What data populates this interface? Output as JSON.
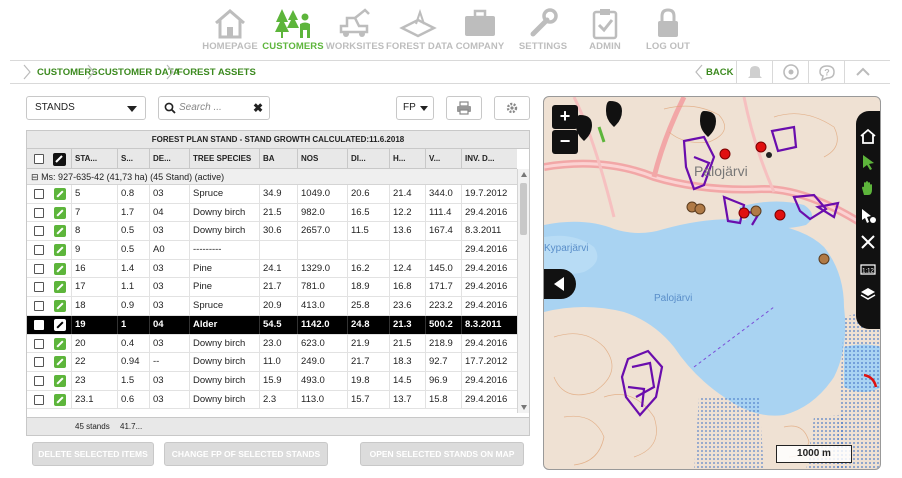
{
  "nav": [
    {
      "label": "HOMEPAGE",
      "icon": "home-icon",
      "active": false
    },
    {
      "label": "CUSTOMERS",
      "icon": "customers-icon",
      "active": true
    },
    {
      "label": "WORKSITES",
      "icon": "worksites-icon",
      "active": false
    },
    {
      "label": "FOREST DATA",
      "icon": "forest-data-icon",
      "active": false
    },
    {
      "label": "COMPANY",
      "icon": "briefcase-icon",
      "active": false
    },
    {
      "label": "SETTINGS",
      "icon": "wrench-icon",
      "active": false
    },
    {
      "label": "ADMIN",
      "icon": "clipboard-icon",
      "active": false
    },
    {
      "label": "LOG OUT",
      "icon": "lock-icon",
      "active": false
    }
  ],
  "breadcrumb": [
    "CUSTOMERS",
    "CUSTOMER DATA",
    "FOREST ASSETS"
  ],
  "back_label": "BACK",
  "controls": {
    "stands_select": "STANDS",
    "search_placeholder": "Search ...",
    "fp_select": "FP"
  },
  "grid": {
    "title": "FOREST PLAN STAND - STAND GROWTH CALCULATED:11.6.2018",
    "columns": [
      "STA...",
      "S...",
      "DE...",
      "TREE SPECIES",
      "BA",
      "NOS",
      "DI...",
      "H...",
      "V...",
      "INV. D..."
    ],
    "group": "Ms: 927-635-42 (41,73 ha) (45 Stand) (active)",
    "rows": [
      [
        "5",
        "0.8",
        "03",
        "Spruce",
        "34.9",
        "1049.0",
        "20.6",
        "21.4",
        "344.0",
        "19.7.2012"
      ],
      [
        "7",
        "1.7",
        "04",
        "Downy birch",
        "21.5",
        "982.0",
        "16.5",
        "12.2",
        "111.4",
        "29.4.2016"
      ],
      [
        "8",
        "0.5",
        "03",
        "Downy birch",
        "30.6",
        "2657.0",
        "11.5",
        "13.6",
        "167.4",
        "8.3.2011"
      ],
      [
        "9",
        "0.5",
        "A0",
        "---------",
        "",
        "",
        "",
        "",
        "",
        "29.4.2016"
      ],
      [
        "16",
        "1.4",
        "03",
        "Pine",
        "24.1",
        "1329.0",
        "16.2",
        "12.4",
        "145.0",
        "29.4.2016"
      ],
      [
        "17",
        "1.1",
        "03",
        "Pine",
        "21.7",
        "781.0",
        "18.9",
        "16.8",
        "171.7",
        "29.4.2016"
      ],
      [
        "18",
        "0.9",
        "03",
        "Spruce",
        "20.9",
        "413.0",
        "25.8",
        "23.6",
        "223.2",
        "29.4.2016"
      ],
      [
        "19",
        "1",
        "04",
        "Alder",
        "54.5",
        "1142.0",
        "24.8",
        "21.3",
        "500.2",
        "8.3.2011"
      ],
      [
        "20",
        "0.4",
        "03",
        "Downy birch",
        "23.0",
        "623.0",
        "21.9",
        "21.5",
        "218.9",
        "29.4.2016"
      ],
      [
        "22",
        "0.94",
        "--",
        "Downy birch",
        "11.0",
        "249.0",
        "21.7",
        "18.3",
        "92.7",
        "17.7.2012"
      ],
      [
        "23",
        "1.5",
        "03",
        "Downy birch",
        "15.9",
        "493.0",
        "19.8",
        "14.5",
        "96.9",
        "29.4.2016"
      ],
      [
        "23.1",
        "0.6",
        "03",
        "Downy birch",
        "2.3",
        "113.0",
        "15.7",
        "13.7",
        "15.8",
        "29.4.2016"
      ]
    ],
    "selected_row": 7,
    "footer_count": "45 stands",
    "footer_area": "41.7..."
  },
  "actions": {
    "delete": "DELETE SELECTED ITEMS",
    "change_fp": "CHANGE FP OF SELECTED STANDS",
    "open_map": "OPEN SELECTED STANDS ON MAP"
  },
  "map": {
    "labels": [
      "Palojärvi",
      "Kyparjärvi",
      "Palojärvi"
    ],
    "scale": "1000 m",
    "zoom_in": "+",
    "zoom_out": "−",
    "colors": {
      "water": "#a9d3f2",
      "land": "#efe1d3",
      "stands": "#6a0dad",
      "road": "#f2a7a7",
      "marker_red": "#e01010",
      "marker_brown": "#b07a46",
      "accent_green": "#5db53b"
    }
  }
}
